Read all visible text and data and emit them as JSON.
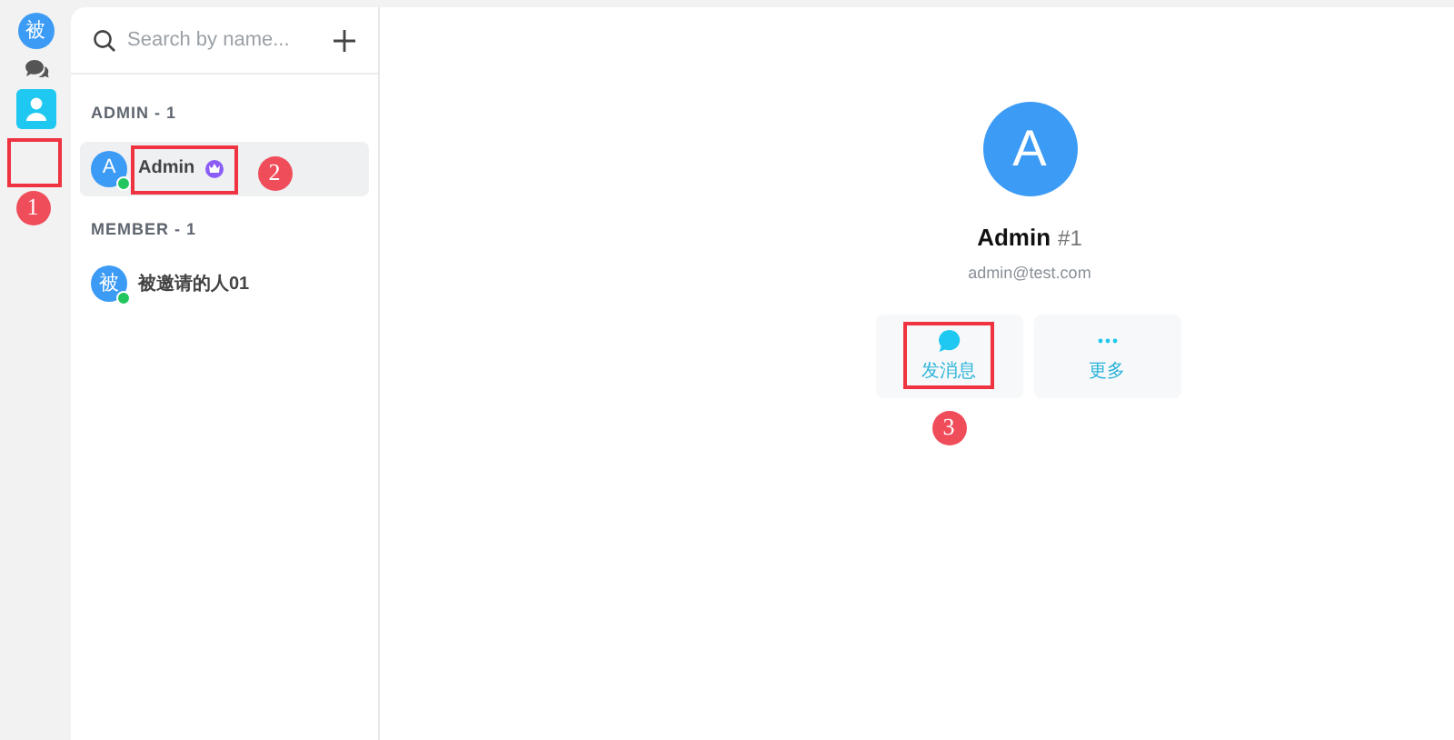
{
  "rail": {
    "avatar": "被",
    "items": [
      {
        "kind": "chats",
        "selected": false
      },
      {
        "kind": "contacts",
        "selected": true
      }
    ]
  },
  "contact_list": {
    "search": {
      "placeholder": "Search by name..."
    },
    "groups": [
      {
        "title": "ADMIN - 1",
        "members": [
          {
            "avatar": "A",
            "name": "Admin",
            "online": true,
            "admin": true,
            "selected": true
          }
        ]
      },
      {
        "title": "MEMBER - 1",
        "members": [
          {
            "avatar": "被",
            "name": "被邀请的人01",
            "online": true,
            "admin": false,
            "selected": false
          }
        ]
      }
    ]
  },
  "profile": {
    "avatar": "A",
    "name": "Admin",
    "number": "#1",
    "email": "admin@test.com",
    "actions": [
      {
        "kind": "message",
        "label": "发消息"
      },
      {
        "kind": "more",
        "label": "更多"
      }
    ]
  },
  "annotations": [
    {
      "label": "1"
    },
    {
      "label": "2"
    },
    {
      "label": "3"
    }
  ]
}
